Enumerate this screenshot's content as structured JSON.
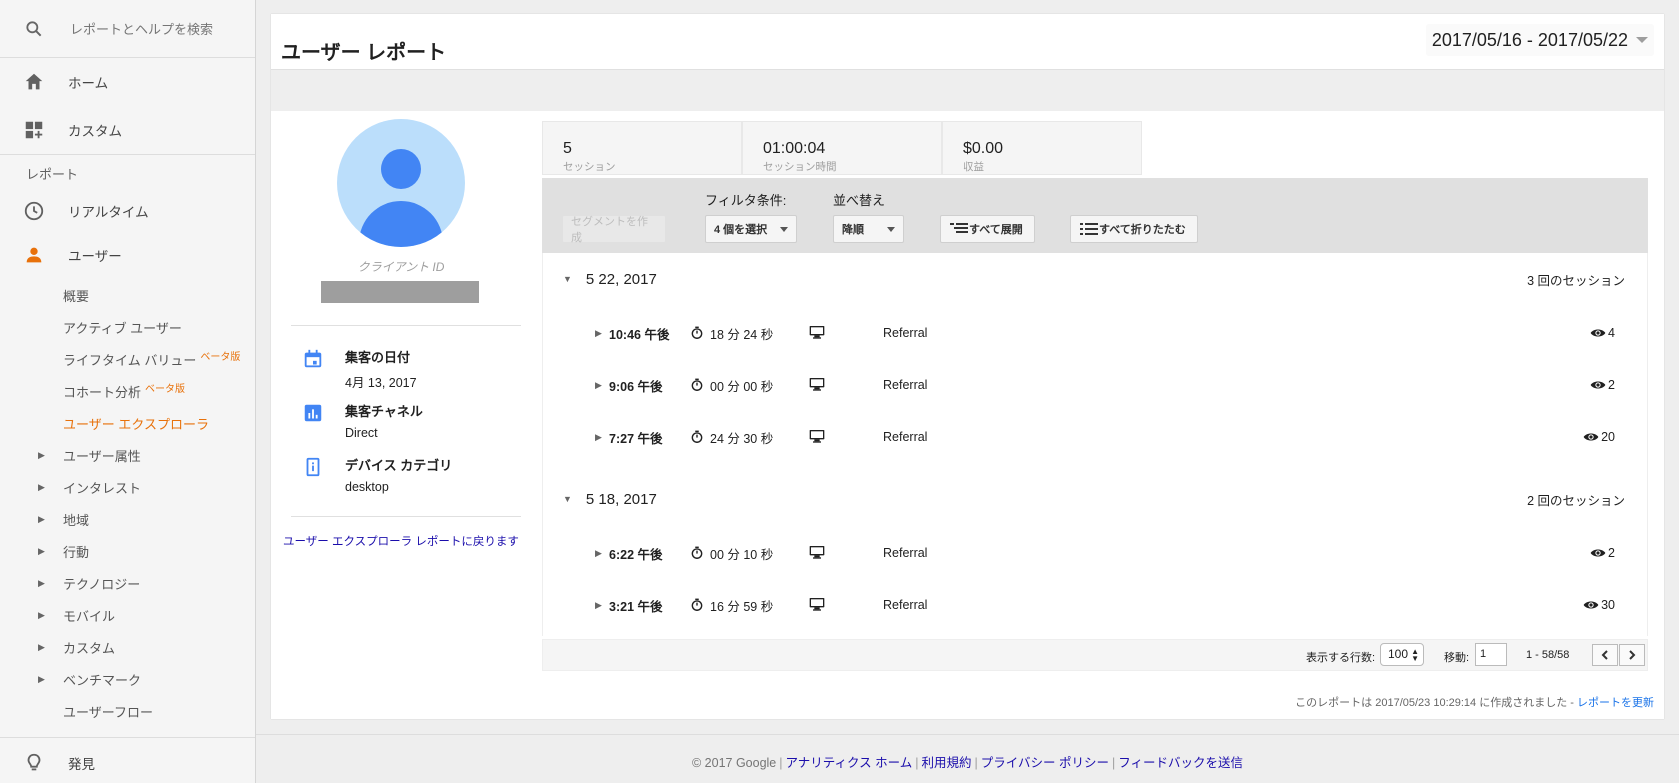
{
  "sidebar": {
    "search_placeholder": "レポートとヘルプを検索",
    "home": "ホーム",
    "custom": "カスタム",
    "reports_section": "レポート",
    "realtime": "リアルタイム",
    "users": "ユーザー",
    "sub_items": [
      "概要",
      "アクティブ ユーザー",
      "ライフタイム バリュー",
      "コホート分析",
      "ユーザー エクスプローラ"
    ],
    "beta_label": "ベータ版",
    "tree_items": [
      "ユーザー属性",
      "インタレスト",
      "地域",
      "行動",
      "テクノロジー",
      "モバイル",
      "カスタム",
      "ベンチマーク"
    ],
    "user_flow": "ユーザーフロー",
    "discover": "発見"
  },
  "header": {
    "title": "ユーザー レポート",
    "date_range": "2017/05/16 - 2017/05/22"
  },
  "profile": {
    "client_id_label": "クライアント ID",
    "acquisition_date_label": "集客の日付",
    "acquisition_date": "4月 13, 2017",
    "channel_label": "集客チャネル",
    "channel": "Direct",
    "device_label": "デバイス カテゴリ",
    "device": "desktop",
    "back_link": "ユーザー エクスプローラ レポートに戻ります"
  },
  "metrics": [
    {
      "value": "5",
      "label": "セッション"
    },
    {
      "value": "01:00:04",
      "label": "セッション時間"
    },
    {
      "value": "$0.00",
      "label": "収益"
    }
  ],
  "toolbar": {
    "segment_button": "セグメントを作成",
    "filter_label": "フィルタ条件:",
    "filter_value": "4 個を選択",
    "sort_label": "並べ替え",
    "sort_value": "降順",
    "expand_all": "すべて展開",
    "collapse_all": "すべて折りたたむ"
  },
  "days": [
    {
      "date": "5 22, 2017",
      "count": "3 回のセッション",
      "sessions": [
        {
          "time": "10:46 午後",
          "duration": "18 分 24 秒",
          "source": "Referral",
          "views": "4"
        },
        {
          "time": "9:06 午後",
          "duration": "00 分 00 秒",
          "source": "Referral",
          "views": "2"
        },
        {
          "time": "7:27 午後",
          "duration": "24 分 30 秒",
          "source": "Referral",
          "views": "20"
        }
      ]
    },
    {
      "date": "5 18, 2017",
      "count": "2 回のセッション",
      "sessions": [
        {
          "time": "6:22 午後",
          "duration": "00 分 10 秒",
          "source": "Referral",
          "views": "2"
        },
        {
          "time": "3:21 午後",
          "duration": "16 分 59 秒",
          "source": "Referral",
          "views": "30"
        }
      ]
    }
  ],
  "pager": {
    "rows_label": "表示する行数:",
    "rows_value": "100",
    "goto_label": "移動:",
    "goto_value": "1",
    "range": "1 - 58/58"
  },
  "footnote": {
    "text": "このレポートは 2017/05/23 10:29:14 に作成されました - ",
    "refresh": "レポートを更新"
  },
  "footer": {
    "copyright": "© 2017 Google",
    "links": [
      "アナリティクス ホーム",
      "利用規約",
      "プライバシー ポリシー",
      "フィードバックを送信"
    ]
  },
  "colors": {
    "accent_orange": "#e8710a",
    "blue": "#4285f4",
    "link": "#1a0dab"
  }
}
